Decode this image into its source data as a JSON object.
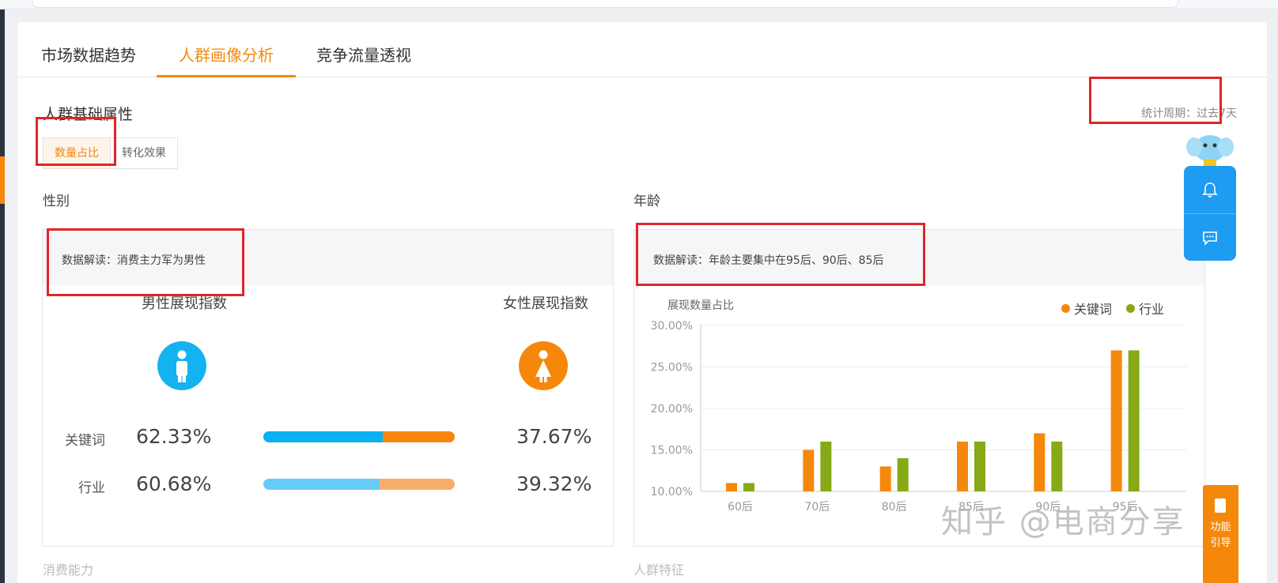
{
  "tabs": [
    {
      "label": "市场数据趋势",
      "active": false
    },
    {
      "label": "人群画像分析",
      "active": true
    },
    {
      "label": "竞争流量透视",
      "active": false
    }
  ],
  "section": {
    "title": "人群基础属性",
    "period": "统计周期：过去7天"
  },
  "segments": [
    {
      "label": "数量占比",
      "active": true
    },
    {
      "label": "转化效果",
      "active": false
    }
  ],
  "gender": {
    "title": "性别",
    "interpretation": "数据解读：消费主力军为男性",
    "male_label": "男性展现指数",
    "female_label": "女性展现指数",
    "male_icon": "male-icon",
    "female_icon": "female-icon",
    "male_color": "#15b2f0",
    "female_color": "#f5880b",
    "rows": [
      {
        "label": "关键词",
        "male_pct": "62.33%",
        "female_pct": "37.67%",
        "male_value": 62.33,
        "male_color": "#0ab0f2",
        "female_color": "#f5880b"
      },
      {
        "label": "行业",
        "male_pct": "60.68%",
        "female_pct": "39.32%",
        "male_value": 60.68,
        "male_color": "#67cbf7",
        "female_color": "#f6ae66"
      }
    ]
  },
  "age": {
    "title": "年龄",
    "interpretation": "数据解读：年龄主要集中在95后、90后、85后"
  },
  "chart_data": {
    "type": "bar",
    "title": "展现数量占比",
    "categories": [
      "60后",
      "70后",
      "80后",
      "85后",
      "90后",
      "95后"
    ],
    "series": [
      {
        "name": "关键词",
        "color": "#f5880b",
        "values": [
          11,
          15,
          13,
          16,
          17,
          27
        ]
      },
      {
        "name": "行业",
        "color": "#88a916",
        "values": [
          11,
          16,
          14,
          16,
          16,
          27
        ]
      }
    ],
    "ylim": [
      10,
      30
    ],
    "yticks": [
      "10.00%",
      "15.00%",
      "20.00%",
      "25.00%",
      "30.00%"
    ],
    "grid": true,
    "legend": "top-right"
  },
  "float_bar": {
    "mascot_icon": "elephant-mascot-icon",
    "bell_icon": "bell-icon",
    "message_icon": "message-icon"
  },
  "guide": {
    "icon": "guide-icon",
    "label_line1": "功能",
    "label_line2": "引导"
  },
  "watermark": "知乎 @电商分享",
  "next_sections": {
    "left": "消费能力",
    "right": "人群特征"
  }
}
